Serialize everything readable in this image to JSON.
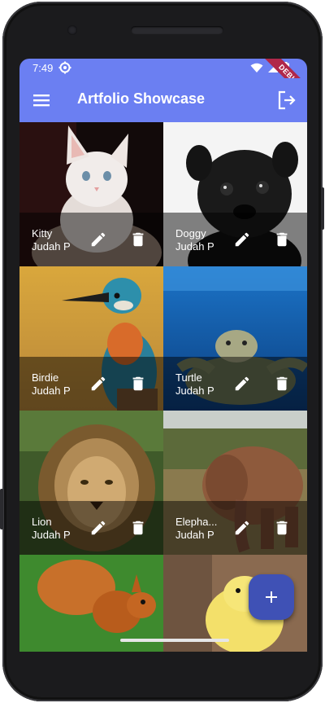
{
  "status_bar": {
    "time": "7:49",
    "settings_icon": "gear-icon",
    "wifi_icon": "wifi-icon",
    "signal_icon": "signal-icon",
    "battery_icon": "battery-icon",
    "debug_banner": "DEBUG"
  },
  "app_bar": {
    "title": "Artfolio Showcase",
    "menu_icon": "hamburger-menu-icon",
    "logout_icon": "logout-icon",
    "background": "#6b7ff2"
  },
  "artworks": [
    {
      "name": "Kitty",
      "owner": "Judah P",
      "subject": "kitten"
    },
    {
      "name": "Doggy",
      "owner": "Judah P",
      "subject": "pug"
    },
    {
      "name": "Birdie",
      "owner": "Judah P",
      "subject": "kingfisher"
    },
    {
      "name": "Turtle",
      "owner": "Judah P",
      "subject": "sea turtle"
    },
    {
      "name": "Lion",
      "owner": "Judah P",
      "subject": "lion"
    },
    {
      "name": "Elepha...",
      "owner": "Judah P",
      "subject": "elephant"
    },
    {
      "name": "",
      "owner": "",
      "subject": "squirrel"
    },
    {
      "name": "",
      "owner": "",
      "subject": "duckling"
    }
  ],
  "tile_actions": {
    "edit_icon": "pencil-icon",
    "delete_icon": "trash-icon"
  },
  "fab": {
    "icon": "plus-icon",
    "color": "#3f51b5"
  }
}
